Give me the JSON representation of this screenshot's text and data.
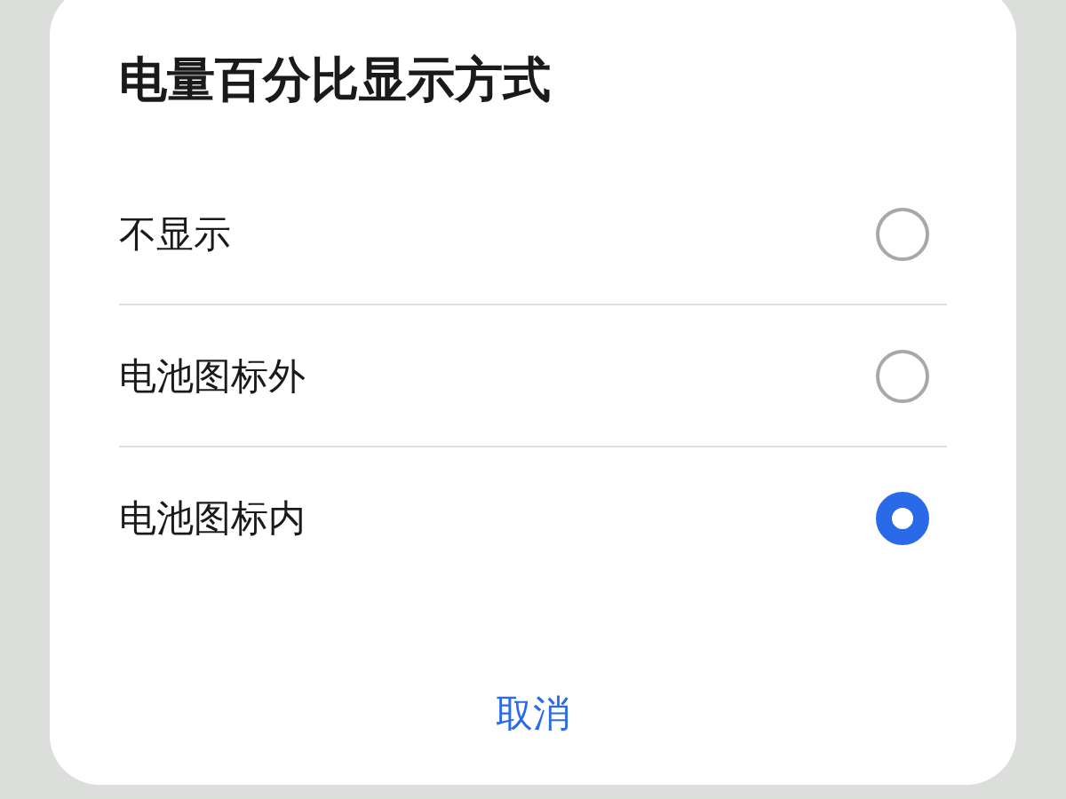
{
  "dialog": {
    "title": "电量百分比显示方式",
    "options": [
      {
        "label": "不显示",
        "selected": false
      },
      {
        "label": "电池图标外",
        "selected": false
      },
      {
        "label": "电池图标内",
        "selected": true
      }
    ],
    "cancel_button": "取消"
  }
}
